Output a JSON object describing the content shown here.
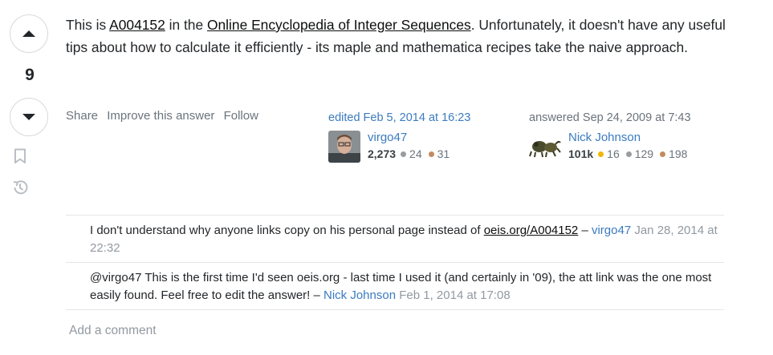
{
  "vote": {
    "count": "9"
  },
  "answer": {
    "t1": "This is ",
    "link1": "A004152",
    "t2": " in the ",
    "link2": "Online Encyclopedia of Integer Sequences",
    "t3": ". Unfortunately, it doesn't have any useful tips about how to calculate it efficiently - its maple and mathematica recipes take the naive approach."
  },
  "menu": {
    "share": "Share",
    "improve": "Improve this answer",
    "follow": "Follow"
  },
  "edited": {
    "action": "edited Feb 5, 2014 at 16:23",
    "user": "virgo47",
    "rep": "2,273",
    "silver": "24",
    "bronze": "31"
  },
  "answered": {
    "action": "answered Sep 24, 2009 at 7:43",
    "user": "Nick Johnson",
    "rep": "101k",
    "gold": "16",
    "silver": "129",
    "bronze": "198"
  },
  "comments": [
    {
      "text_before": "I don't understand why anyone links copy on his personal page instead of ",
      "link": "oeis.org/A004152",
      "text_after": " – ",
      "user": "virgo47",
      "date": "Jan 28, 2014 at 22:32"
    },
    {
      "text": "@virgo47 This is the first time I'd seen oeis.org - last time I used it (and certainly in '09), the att link was the one most easily found. Feel free to edit the answer! – ",
      "user": "Nick Johnson",
      "date": "Feb 1, 2014 at 17:08"
    }
  ],
  "add_comment": "Add a comment",
  "colors": {
    "link_blue": "#3b7bbf",
    "gold": "#f1b600",
    "silver": "#9a9ca0",
    "bronze": "#c38b5f"
  }
}
